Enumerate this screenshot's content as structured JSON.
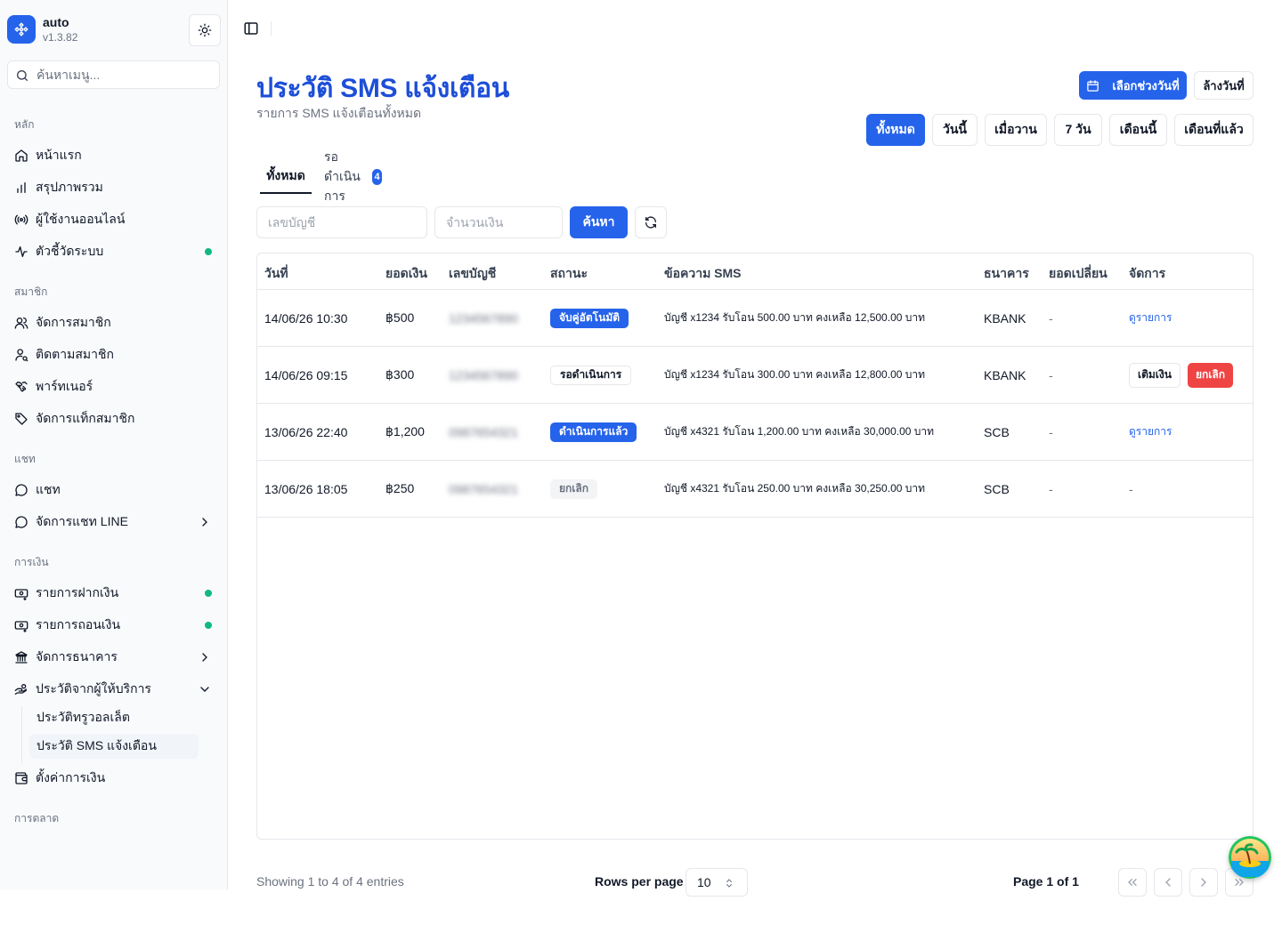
{
  "app": {
    "name": "auto",
    "version": "v1.3.82"
  },
  "sidebar": {
    "search_placeholder": "ค้นหาเมนู...",
    "groups": {
      "main": "หลัก",
      "members": "สมาชิก",
      "chat": "แชท",
      "finance": "การเงิน",
      "marketing": "การตลาด"
    },
    "items": {
      "home": "หน้าแรก",
      "overview": "สรุปภาพรวม",
      "online_users": "ผู้ใช้งานออนไลน์",
      "system_metrics": "ตัวชี้วัดระบบ",
      "manage_members": "จัดการสมาชิก",
      "track_members": "ติดตามสมาชิก",
      "partners": "พาร์ทเนอร์",
      "member_tags": "จัดการแท็กสมาชิก",
      "chat": "แชท",
      "line_chat": "จัดการแชท LINE",
      "deposits": "รายการฝากเงิน",
      "withdrawals": "รายการถอนเงิน",
      "banks": "จัดการธนาคาร",
      "provider_history": "ประวัติจากผู้ให้บริการ",
      "truewallet_history": "ประวัติทรูวอลเล็ต",
      "sms_history": "ประวัติ SMS แจ้งเตือน",
      "finance_settings": "ตั้งค่าการเงิน"
    }
  },
  "page": {
    "title": "ประวัติ SMS แจ้งเตือน",
    "subtitle": "รายการ SMS แจ้งเตือนทั้งหมด",
    "date_picker_label": "เลือกช่วงวันที่",
    "clear_date_label": "ล้างวันที่",
    "range_buttons": [
      "ทั้งหมด",
      "วันนี้",
      "เมื่อวาน",
      "7 วัน",
      "เดือนนี้",
      "เดือนที่แล้ว"
    ],
    "tabs": {
      "all": "ทั้งหมด",
      "pending": "รอดำเนินการ",
      "pending_count": "4"
    },
    "filters": {
      "account_placeholder": "เลขบัญชี",
      "amount_placeholder": "จำนวนเงิน",
      "search_label": "ค้นหา"
    }
  },
  "table": {
    "columns": [
      "วันที่",
      "ยอดเงิน",
      "เลขบัญชี",
      "สถานะ",
      "ข้อความ SMS",
      "ธนาคาร",
      "ยอดเปลี่ยน",
      "จัดการ"
    ],
    "rows": [
      {
        "date": "14/06/26 10:30",
        "amount": "฿500",
        "account": "1234567890",
        "status": "จับคู่อัตโนมัติ",
        "sms": "บัญชี x1234 รับโอน 500.00 บาท คงเหลือ 12,500.00 บาท",
        "bank": "KBANK",
        "change": "-",
        "action_link": "ดูรายการ"
      },
      {
        "date": "14/06/26 09:15",
        "amount": "฿300",
        "account": "1234567890",
        "status": "รอดำเนินการ",
        "sms": "บัญชี x1234 รับโอน 300.00 บาท คงเหลือ 12,800.00 บาท",
        "bank": "KBANK",
        "change": "-",
        "action_topup": "เติมเงิน",
        "action_cancel": "ยกเลิก"
      },
      {
        "date": "13/06/26 22:40",
        "amount": "฿1,200",
        "account": "0987654321",
        "status": "ดำเนินการแล้ว",
        "sms": "บัญชี x4321 รับโอน 1,200.00 บาท คงเหลือ 30,000.00 บาท",
        "bank": "SCB",
        "change": "-",
        "action_link": "ดูรายการ"
      },
      {
        "date": "13/06/26 18:05",
        "amount": "฿250",
        "account": "0987654321",
        "status": "ยกเลิก",
        "sms": "บัญชี x4321 รับโอน 250.00 บาท คงเหลือ 30,250.00 บาท",
        "bank": "SCB",
        "change": "-",
        "action_none": "-"
      }
    ]
  },
  "footer": {
    "showing": "Showing 1 to 4 of 4 entries",
    "rows_per_page_label": "Rows per page",
    "rows_per_page_value": "10",
    "page_info": "Page 1 of 1"
  },
  "colors": {
    "primary": "#2563eb",
    "title": "#1d4ed8",
    "danger": "#ef4444",
    "online_dot": "#10b981",
    "sidebar_bg": "#f8fafc"
  },
  "icons": {
    "logo": "puzzle-icon",
    "theme": "sun-icon",
    "search": "search-icon",
    "calendar": "calendar-icon",
    "refresh": "refresh-icon"
  }
}
